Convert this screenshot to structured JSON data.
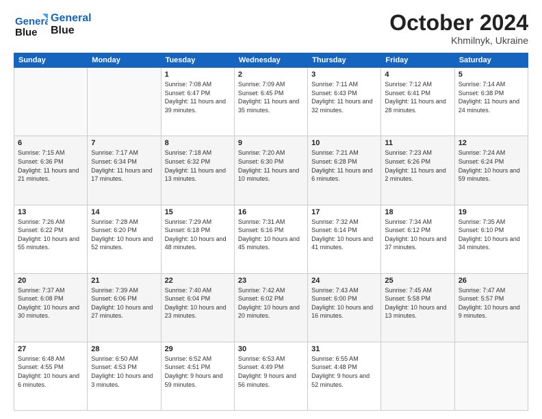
{
  "header": {
    "logo_line1": "General",
    "logo_line2": "Blue",
    "month": "October 2024",
    "location": "Khmilnyk, Ukraine"
  },
  "days_of_week": [
    "Sunday",
    "Monday",
    "Tuesday",
    "Wednesday",
    "Thursday",
    "Friday",
    "Saturday"
  ],
  "weeks": [
    [
      {
        "day": "",
        "info": ""
      },
      {
        "day": "",
        "info": ""
      },
      {
        "day": "1",
        "info": "Sunrise: 7:08 AM\nSunset: 6:47 PM\nDaylight: 11 hours and 39 minutes."
      },
      {
        "day": "2",
        "info": "Sunrise: 7:09 AM\nSunset: 6:45 PM\nDaylight: 11 hours and 35 minutes."
      },
      {
        "day": "3",
        "info": "Sunrise: 7:11 AM\nSunset: 6:43 PM\nDaylight: 11 hours and 32 minutes."
      },
      {
        "day": "4",
        "info": "Sunrise: 7:12 AM\nSunset: 6:41 PM\nDaylight: 11 hours and 28 minutes."
      },
      {
        "day": "5",
        "info": "Sunrise: 7:14 AM\nSunset: 6:38 PM\nDaylight: 11 hours and 24 minutes."
      }
    ],
    [
      {
        "day": "6",
        "info": "Sunrise: 7:15 AM\nSunset: 6:36 PM\nDaylight: 11 hours and 21 minutes."
      },
      {
        "day": "7",
        "info": "Sunrise: 7:17 AM\nSunset: 6:34 PM\nDaylight: 11 hours and 17 minutes."
      },
      {
        "day": "8",
        "info": "Sunrise: 7:18 AM\nSunset: 6:32 PM\nDaylight: 11 hours and 13 minutes."
      },
      {
        "day": "9",
        "info": "Sunrise: 7:20 AM\nSunset: 6:30 PM\nDaylight: 11 hours and 10 minutes."
      },
      {
        "day": "10",
        "info": "Sunrise: 7:21 AM\nSunset: 6:28 PM\nDaylight: 11 hours and 6 minutes."
      },
      {
        "day": "11",
        "info": "Sunrise: 7:23 AM\nSunset: 6:26 PM\nDaylight: 11 hours and 2 minutes."
      },
      {
        "day": "12",
        "info": "Sunrise: 7:24 AM\nSunset: 6:24 PM\nDaylight: 10 hours and 59 minutes."
      }
    ],
    [
      {
        "day": "13",
        "info": "Sunrise: 7:26 AM\nSunset: 6:22 PM\nDaylight: 10 hours and 55 minutes."
      },
      {
        "day": "14",
        "info": "Sunrise: 7:28 AM\nSunset: 6:20 PM\nDaylight: 10 hours and 52 minutes."
      },
      {
        "day": "15",
        "info": "Sunrise: 7:29 AM\nSunset: 6:18 PM\nDaylight: 10 hours and 48 minutes."
      },
      {
        "day": "16",
        "info": "Sunrise: 7:31 AM\nSunset: 6:16 PM\nDaylight: 10 hours and 45 minutes."
      },
      {
        "day": "17",
        "info": "Sunrise: 7:32 AM\nSunset: 6:14 PM\nDaylight: 10 hours and 41 minutes."
      },
      {
        "day": "18",
        "info": "Sunrise: 7:34 AM\nSunset: 6:12 PM\nDaylight: 10 hours and 37 minutes."
      },
      {
        "day": "19",
        "info": "Sunrise: 7:35 AM\nSunset: 6:10 PM\nDaylight: 10 hours and 34 minutes."
      }
    ],
    [
      {
        "day": "20",
        "info": "Sunrise: 7:37 AM\nSunset: 6:08 PM\nDaylight: 10 hours and 30 minutes."
      },
      {
        "day": "21",
        "info": "Sunrise: 7:39 AM\nSunset: 6:06 PM\nDaylight: 10 hours and 27 minutes."
      },
      {
        "day": "22",
        "info": "Sunrise: 7:40 AM\nSunset: 6:04 PM\nDaylight: 10 hours and 23 minutes."
      },
      {
        "day": "23",
        "info": "Sunrise: 7:42 AM\nSunset: 6:02 PM\nDaylight: 10 hours and 20 minutes."
      },
      {
        "day": "24",
        "info": "Sunrise: 7:43 AM\nSunset: 6:00 PM\nDaylight: 10 hours and 16 minutes."
      },
      {
        "day": "25",
        "info": "Sunrise: 7:45 AM\nSunset: 5:58 PM\nDaylight: 10 hours and 13 minutes."
      },
      {
        "day": "26",
        "info": "Sunrise: 7:47 AM\nSunset: 5:57 PM\nDaylight: 10 hours and 9 minutes."
      }
    ],
    [
      {
        "day": "27",
        "info": "Sunrise: 6:48 AM\nSunset: 4:55 PM\nDaylight: 10 hours and 6 minutes."
      },
      {
        "day": "28",
        "info": "Sunrise: 6:50 AM\nSunset: 4:53 PM\nDaylight: 10 hours and 3 minutes."
      },
      {
        "day": "29",
        "info": "Sunrise: 6:52 AM\nSunset: 4:51 PM\nDaylight: 9 hours and 59 minutes."
      },
      {
        "day": "30",
        "info": "Sunrise: 6:53 AM\nSunset: 4:49 PM\nDaylight: 9 hours and 56 minutes."
      },
      {
        "day": "31",
        "info": "Sunrise: 6:55 AM\nSunset: 4:48 PM\nDaylight: 9 hours and 52 minutes."
      },
      {
        "day": "",
        "info": ""
      },
      {
        "day": "",
        "info": ""
      }
    ]
  ]
}
